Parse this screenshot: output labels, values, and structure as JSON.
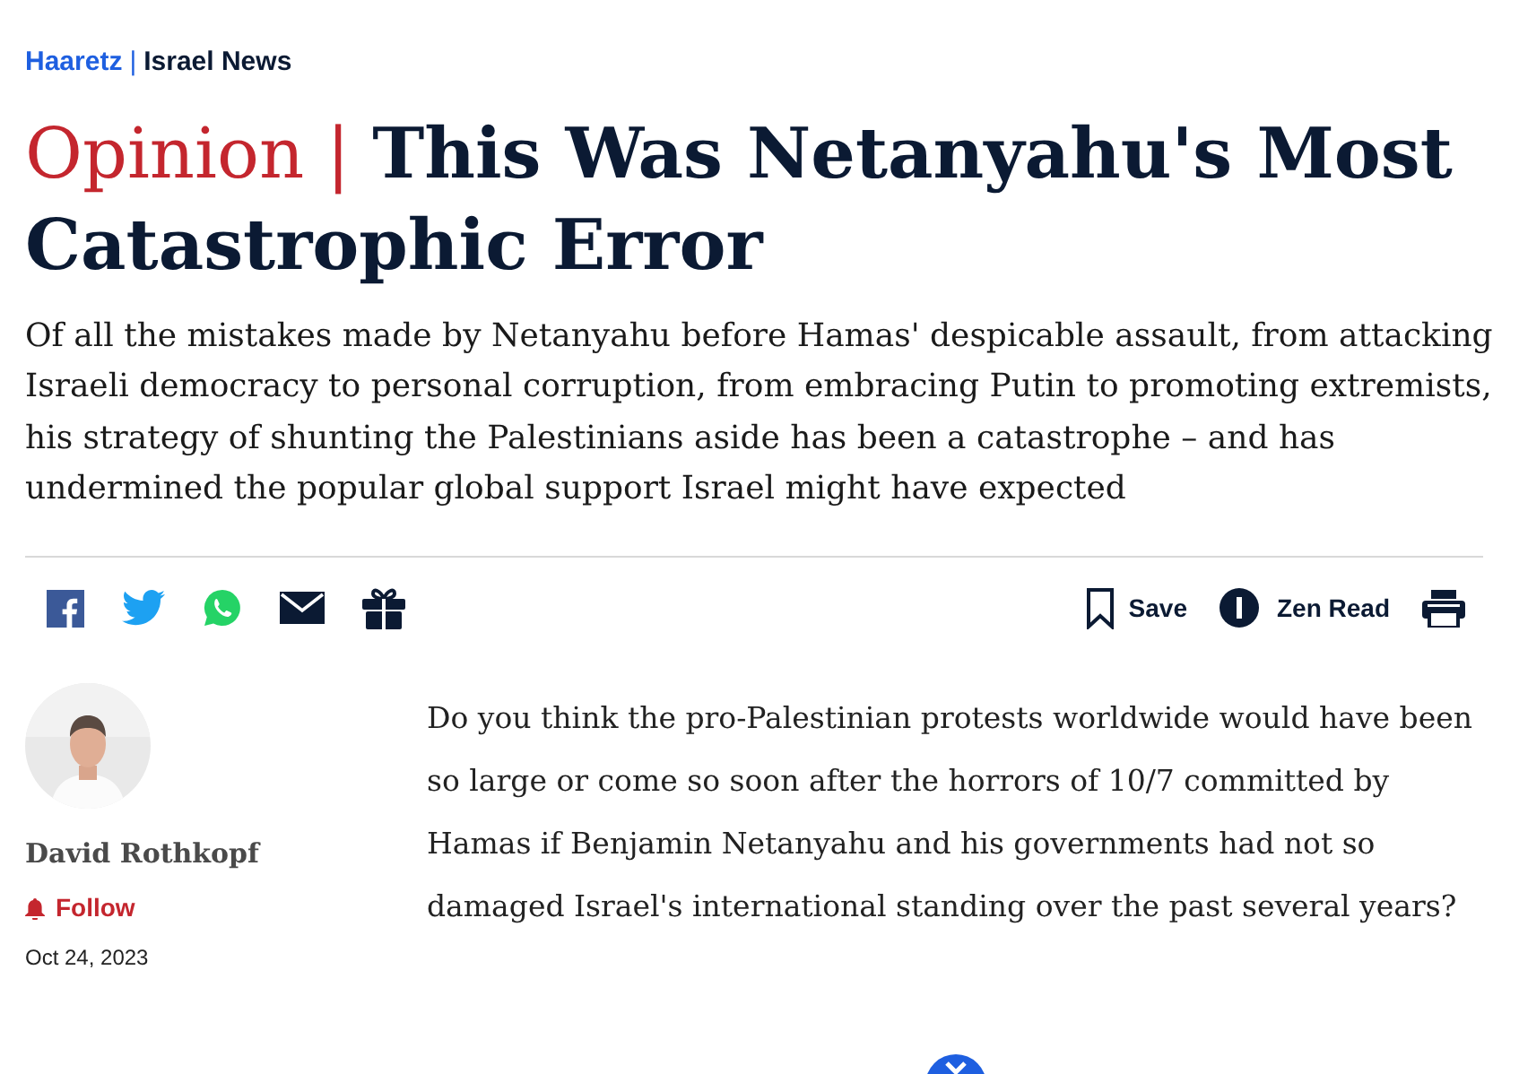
{
  "breadcrumb": {
    "site": "Haaretz",
    "separator": "|",
    "section": "Israel News"
  },
  "headline": {
    "label": "Opinion",
    "separator": "|",
    "title": "This Was Netanyahu's Most Catastrophic Error"
  },
  "subtitle": "Of all the mistakes made by Netanyahu before Hamas' despicable assault, from attacking Israeli democracy to personal corruption, from embracing Putin to promoting extremists, his strategy of shunting the Palestinians aside has been a catastrophe – and has undermined the popular global support Israel might have expected",
  "share_icons": [
    {
      "kind": "facebook"
    },
    {
      "kind": "twitter"
    },
    {
      "kind": "whatsapp"
    },
    {
      "kind": "email"
    },
    {
      "kind": "gift"
    }
  ],
  "actions": [
    {
      "kind": "save",
      "label": "Save"
    },
    {
      "kind": "zen",
      "label": "Zen Read"
    },
    {
      "kind": "print"
    }
  ],
  "author": {
    "name": "David Rothkopf",
    "follow": "Follow",
    "date": "Oct 24, 2023"
  },
  "body": "Do you think the pro-Palestinian protests worldwide would have been so large or come so soon after the horrors of 10/7 committed by Hamas if Benjamin Netanyahu and his governments had not so damaged Israel's international standing over the past several years?"
}
